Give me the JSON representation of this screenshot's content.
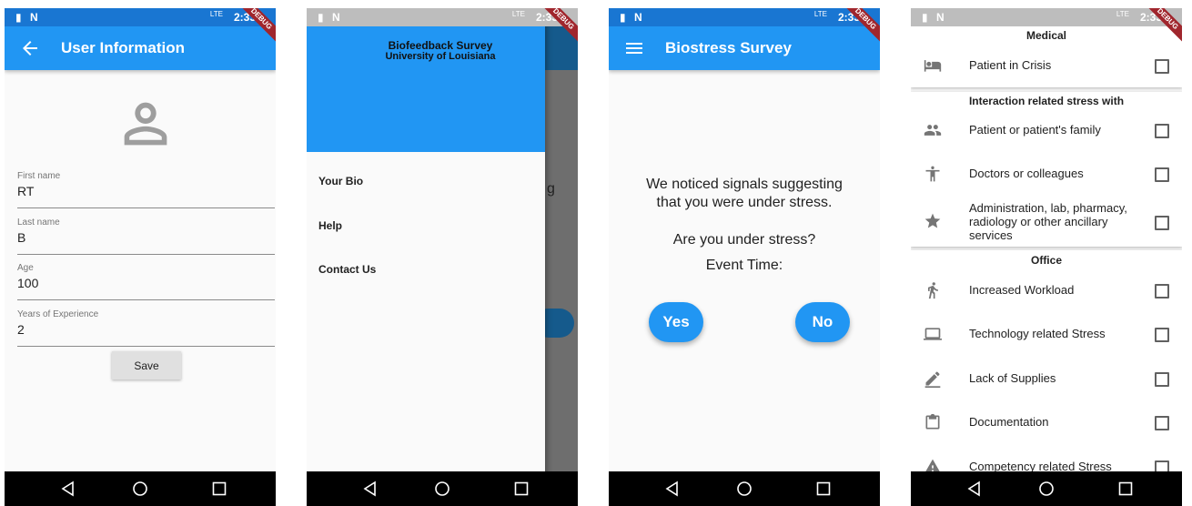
{
  "status": {
    "time": "2:33",
    "debug": "DEBUG",
    "network": "LTE"
  },
  "colors": {
    "primary": "#2196f3",
    "status_bar": "#1976d2",
    "debug_banner": "#a0262d"
  },
  "screen1": {
    "title": "User Information",
    "leading_icon": "arrow-back-icon",
    "avatar_icon": "person-icon",
    "fields": [
      {
        "label": "First name",
        "value": "RT"
      },
      {
        "label": "Last name",
        "value": "B"
      },
      {
        "label": "Age",
        "value": "100"
      },
      {
        "label": "Years of Experience",
        "value": "2"
      }
    ],
    "save_label": "Save"
  },
  "screen2": {
    "drawer_title": "Biofeedback Survey",
    "drawer_subtitle": "University of Louisiana",
    "items": [
      "Your Bio",
      "Help",
      "Contact Us"
    ],
    "behind_text": "g"
  },
  "screen3": {
    "title": "Biostress Survey",
    "leading_icon": "menu-icon",
    "message_line1": "We noticed signals suggesting",
    "message_line2": "that you were under stress.",
    "question": "Are you under stress?",
    "event_time": "Event Time:",
    "yes_label": "Yes",
    "no_label": "No"
  },
  "screen4": {
    "sections": [
      {
        "title": "Medical",
        "items": [
          {
            "icon": "hotel-bed-icon",
            "label": "Patient in Crisis",
            "checked": false
          }
        ]
      },
      {
        "title": "Interaction related stress with",
        "items": [
          {
            "icon": "people-icon",
            "label": "Patient or patient's family",
            "checked": false
          },
          {
            "icon": "accessibility-icon",
            "label": "Doctors or colleagues",
            "checked": false
          },
          {
            "icon": "star-icon",
            "label": "Administration, lab, pharmacy, radiology or other ancillary services",
            "checked": false
          }
        ]
      },
      {
        "title": "Office",
        "items": [
          {
            "icon": "walk-icon",
            "label": "Increased Workload",
            "checked": false
          },
          {
            "icon": "laptop-icon",
            "label": "Technology related Stress",
            "checked": false
          },
          {
            "icon": "edit-icon",
            "label": "Lack of Supplies",
            "checked": false
          },
          {
            "icon": "clipboard-icon",
            "label": "Documentation",
            "checked": false
          },
          {
            "icon": "warning-icon",
            "label": "Competency related Stress",
            "checked": false
          }
        ]
      }
    ]
  }
}
